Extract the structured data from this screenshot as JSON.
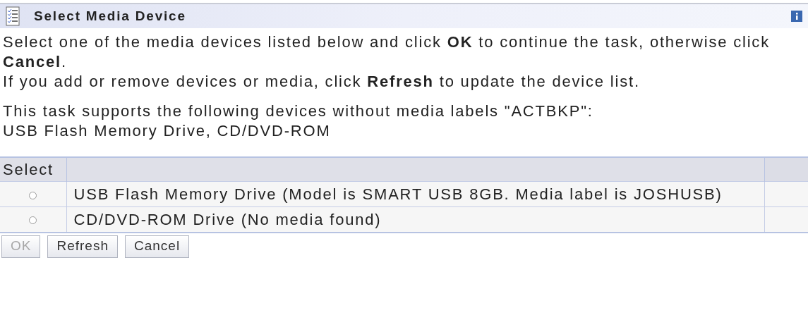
{
  "header": {
    "title": "Select Media Device"
  },
  "paragraphs": [
    "Select one of the media devices listed below and click **OK** to continue the task, otherwise click **Cancel**.",
    "If you add or remove devices or media, click **Refresh** to update the device list."
  ],
  "support": [
    "This task supports the following devices without media labels \"ACTBKP\":",
    "USB Flash Memory Drive, CD/DVD-ROM"
  ],
  "table": {
    "columns": [
      "Select"
    ],
    "rows": [
      {
        "selected": false,
        "device": "USB Flash Memory Drive (Model is SMART USB 8GB. Media label is JOSHUSB)"
      },
      {
        "selected": false,
        "device": "CD/DVD-ROM Drive (No media found)"
      }
    ]
  },
  "buttons": [
    {
      "label": "OK",
      "disabled": true
    },
    {
      "label": "Refresh",
      "disabled": false
    },
    {
      "label": "Cancel",
      "disabled": false
    }
  ]
}
